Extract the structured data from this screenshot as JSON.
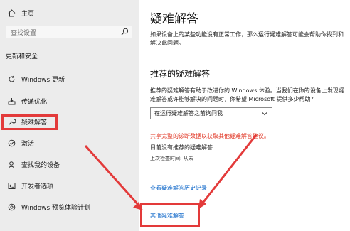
{
  "sidebar": {
    "home": "主页",
    "search_placeholder": "查找设置",
    "section_title": "更新和安全",
    "items": [
      {
        "label": "Windows 更新"
      },
      {
        "label": "传递优化"
      },
      {
        "label": "疑难解答"
      },
      {
        "label": "激活"
      },
      {
        "label": "查找我的设备"
      },
      {
        "label": "开发者选项"
      },
      {
        "label": "Windows 预览体验计划"
      }
    ]
  },
  "main": {
    "title": "疑难解答",
    "description": "如果设备上的某些功能没有正常工作，那么运行疑难解答可能会帮助你找到和解决此问题。",
    "recommended_heading": "推荐的疑难解答",
    "recommended_description": "推荐的疑难解答有助于改进你的 Windows 体验。当我们在你的设备上发现疑难解答或许能够解决的问题时，你希望 Microsoft 提供多少帮助?",
    "dropdown_value": "在运行疑难解答之前询问我",
    "notice": "共享完整的诊断数据以获取其他疑难解答建议。",
    "status": "目前没有推荐的疑难解答",
    "last_checked": "上次检查时间: 从未",
    "history_link": "查看疑难解答历史记录",
    "other_link": "其他疑难解答"
  },
  "colors": {
    "accent": "#0a64c8",
    "highlight_red": "#e33a3a",
    "sidebar_bg": "#ececec"
  }
}
